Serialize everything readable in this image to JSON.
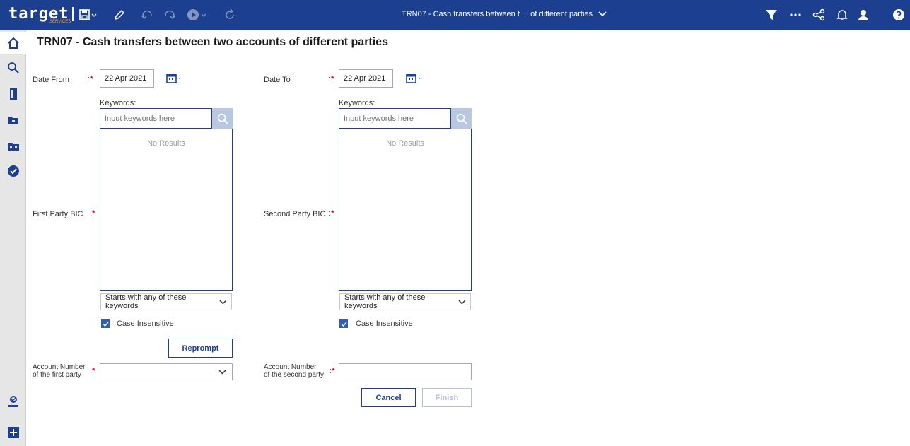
{
  "app": {
    "logo_text": "target",
    "logo_sub": "SERVICES",
    "window_title": "TRN07 - Cash transfers between t ... of different parties"
  },
  "page": {
    "title": "TRN07 - Cash transfers between two accounts of different parties"
  },
  "form": {
    "date_from": {
      "label": "Date From",
      "colon": ":",
      "required_mark": "*",
      "value": "22 Apr 2021"
    },
    "date_to": {
      "label": "Date To",
      "colon": ":",
      "required_mark": "*",
      "value": "22 Apr 2021"
    },
    "first_party_bic": {
      "label": "First Party BIC",
      "colon": ":",
      "required_mark": "*",
      "keywords_label": "Keywords:",
      "placeholder": "Input keywords here",
      "no_results": "No Results",
      "match_mode": "Starts with any of these keywords",
      "case_insensitive_label": "Case Insensitive",
      "case_insensitive_checked": true
    },
    "second_party_bic": {
      "label": "Second Party BIC",
      "colon": ":",
      "required_mark": "*",
      "keywords_label": "Keywords:",
      "placeholder": "Input keywords here",
      "no_results": "No Results",
      "match_mode": "Starts with any of these keywords",
      "case_insensitive_label": "Case Insensitive",
      "case_insensitive_checked": true
    },
    "reprompt_label": "Reprompt",
    "account_first": {
      "label_line1": "Account Number",
      "label_line2": "of the first party",
      "colon": ":",
      "required_mark": "*",
      "value": ""
    },
    "account_second": {
      "label_line1": "Account Number",
      "label_line2": "of the second party",
      "colon": ":",
      "required_mark": "*",
      "value": ""
    },
    "cancel_label": "Cancel",
    "finish_label": "Finish"
  },
  "colors": {
    "topbar": "#1d3f8f",
    "accent": "#2f5fb3",
    "required": "#d0021b"
  },
  "icons": {
    "toolbar": [
      "save-icon",
      "edit-icon",
      "undo-icon",
      "redo-icon",
      "play-icon",
      "refresh-icon"
    ],
    "right": [
      "filter-icon",
      "more-icon",
      "share-icon",
      "bell-icon",
      "user-icon",
      "help-icon"
    ],
    "sidebar": [
      "home-icon",
      "search-icon",
      "document-icon",
      "folder-icon",
      "folders-icon",
      "check-circle-icon",
      "user-badge-icon",
      "add-icon"
    ]
  }
}
